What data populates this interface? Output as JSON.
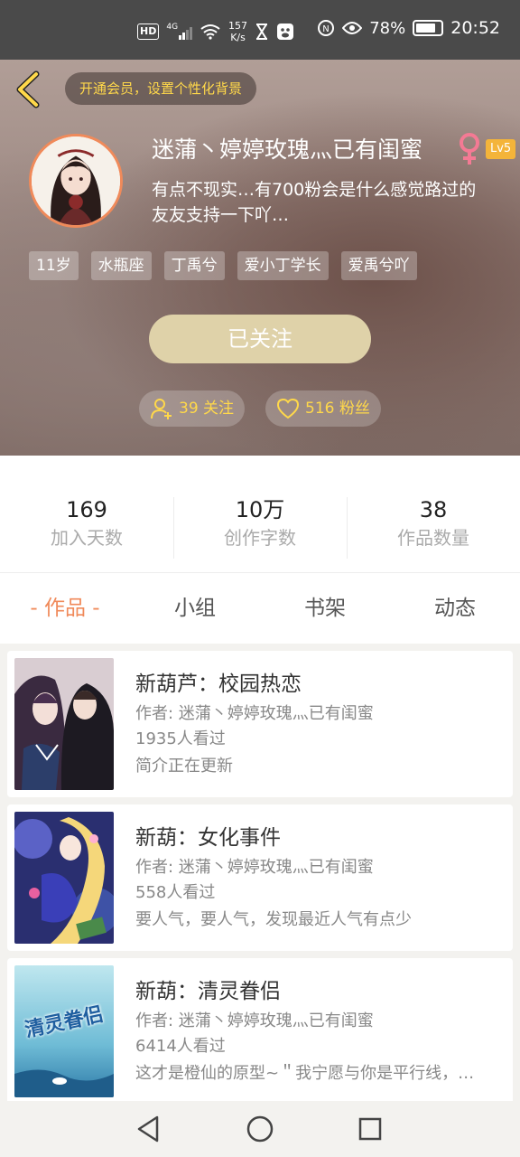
{
  "status_bar": {
    "hd": "HD",
    "network": "4G",
    "speed_top": "157",
    "speed_bottom": "K/s",
    "battery": "78%",
    "time": "20:52"
  },
  "header": {
    "vip_banner": "开通会员，设置个性化背景",
    "nickname": "迷蒲丶婷婷玫瑰灬已有闺蜜",
    "level": "Lv5",
    "bio": "有点不现实…有700粉会是什么感觉路过的友友支持一下吖…",
    "tags": [
      "11岁",
      "水瓶座",
      "丁禹兮",
      "爱小丁学长",
      "爱禹兮吖"
    ],
    "follow_button": "已关注",
    "following": "39 关注",
    "fans": "516 粉丝"
  },
  "stats": [
    {
      "value": "169",
      "label": "加入天数"
    },
    {
      "value": "10万",
      "label": "创作字数"
    },
    {
      "value": "38",
      "label": "作品数量"
    }
  ],
  "tabs": [
    "- 作品 -",
    "小组",
    "书架",
    "动态"
  ],
  "works": [
    {
      "title": "新葫芦：校园热恋",
      "author": "作者: 迷蒲丶婷婷玫瑰灬已有闺蜜",
      "views": "1935人看过",
      "intro": "简介正在更新"
    },
    {
      "title": "新葫：女化事件",
      "author": "作者: 迷蒲丶婷婷玫瑰灬已有闺蜜",
      "views": "558人看过",
      "intro": "要人气，要人气，发现最近人气有点少"
    },
    {
      "title": "新葫：清灵眷侣",
      "author": "作者: 迷蒲丶婷婷玫瑰灬已有闺蜜",
      "views": "6414人看过",
      "intro": "这才是橙仙的原型~＂我宁愿与你是平行线，…",
      "cover_text": "清灵眷侣"
    }
  ],
  "colors": {
    "accent": "#f08a5a",
    "vip_yellow": "#ffd84a",
    "follow_btn": "#dfd2a9",
    "level_badge": "#f4b43a"
  }
}
